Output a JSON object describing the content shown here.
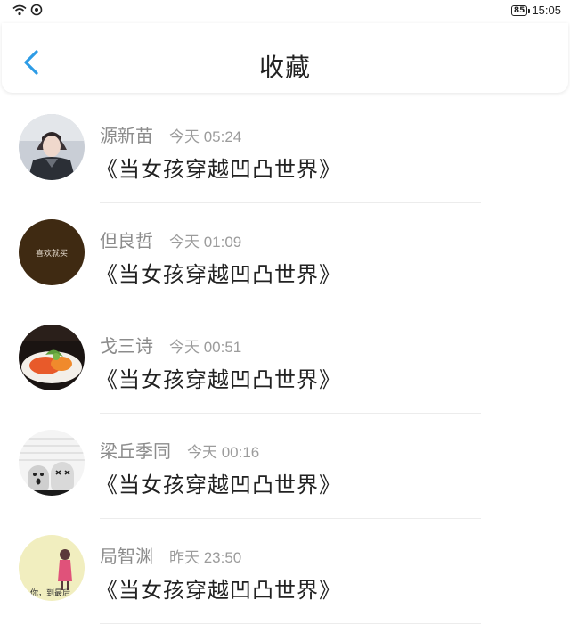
{
  "status_bar": {
    "time": "15:05",
    "battery": "85",
    "icons": [
      "wifi-icon",
      "data-saver-icon"
    ]
  },
  "header": {
    "title": "收藏",
    "back_icon": "chevron-left-icon",
    "accent_color": "#2d9ce6"
  },
  "items": [
    {
      "name": "源新苗",
      "time": "今天 05:24",
      "book": "《当女孩穿越凹凸世界》",
      "avatar": "portrait-boy-avatar"
    },
    {
      "name": "但良哲",
      "time": "今天 01:09",
      "book": "《当女孩穿越凹凸世界》",
      "avatar": "text-avatar",
      "avatar_text": "喜欢就买"
    },
    {
      "name": "戈三诗",
      "time": "今天 00:51",
      "book": "《当女孩穿越凹凸世界》",
      "avatar": "food-avatar"
    },
    {
      "name": "梁丘季同",
      "time": "今天 00:16",
      "book": "《当女孩穿越凹凸世界》",
      "avatar": "cartoon-avatar"
    },
    {
      "name": "局智渊",
      "time": "昨天 23:50",
      "book": "《当女孩穿越凹凸世界》",
      "avatar": "girl-avatar",
      "avatar_text": "…你，到最后"
    }
  ]
}
